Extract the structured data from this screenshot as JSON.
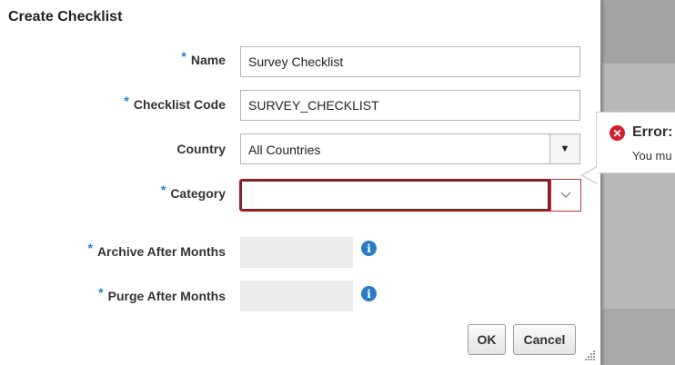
{
  "dialog": {
    "title": "Create Checklist"
  },
  "form": {
    "required_marker": "*",
    "name": {
      "label": "Name",
      "value": "Survey Checklist"
    },
    "checklist_code": {
      "label": "Checklist Code",
      "value": "SURVEY_CHECKLIST"
    },
    "country": {
      "label": "Country",
      "selected": "All Countries"
    },
    "category": {
      "label": "Category",
      "value": ""
    },
    "archive_after_months": {
      "label": "Archive After Months",
      "value": ""
    },
    "purge_after_months": {
      "label": "Purge After Months",
      "value": ""
    }
  },
  "buttons": {
    "ok": "OK",
    "cancel": "Cancel"
  },
  "error_popup": {
    "title": "Error:",
    "message": "You mu"
  },
  "icons": {
    "info": "info-icon",
    "error": "error-icon",
    "dropdown": "chevron-down-icon"
  },
  "colors": {
    "required_marker": "#1d7ed6",
    "error_border": "#b3111e",
    "error_icon": "#d21f2e",
    "info_icon": "#2b7bc4"
  }
}
